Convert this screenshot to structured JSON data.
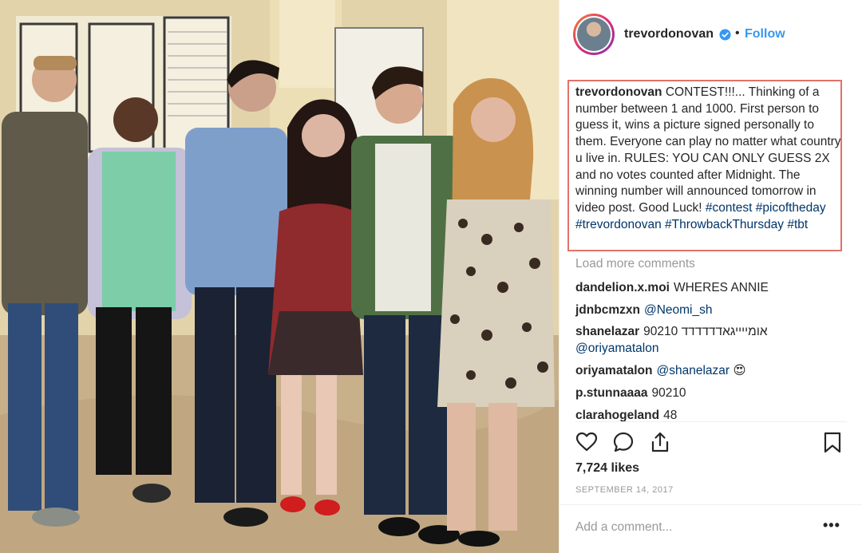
{
  "post": {
    "username": "trevordonovan",
    "follow_label": "Follow",
    "separator": "•",
    "caption_user": "trevordonovan",
    "caption_text": "CONTEST!!!... Thinking of a number between 1 and 1000. First person to guess it, wins a picture signed personally to them. Everyone can play no matter what country u live in. RULES: YOU CAN ONLY GUESS 2X and no votes counted after Midnight. The winning number will announced tomorrow in video post. Good Luck!",
    "hashtags_line1": "#contest #picoftheday",
    "hashtags_line2": "#trevordonovan #ThrowbackThursday #tbt",
    "load_more": "Load more comments",
    "likes": "7,724 likes",
    "date": "SEPTEMBER 14, 2017",
    "add_comment_placeholder": "Add a comment...",
    "more_label": "•••"
  },
  "comments": [
    {
      "user": "dandelion.x.moi",
      "text": "WHERES ANNIE"
    },
    {
      "user": "jdnbcmzxn",
      "text": "@Neomi_sh"
    },
    {
      "user": "shanelazar",
      "text": "90210 אומייייגאדדדדדד",
      "text2": "@oriyamatalon"
    },
    {
      "user": "oriyamatalon",
      "text": "@shanelazar",
      "emoji": "😍"
    },
    {
      "user": "p.stunnaaaa",
      "text": "90210"
    },
    {
      "user": "clarahogeland",
      "text": "48"
    }
  ],
  "icons": {
    "verified": "verified-badge-icon",
    "like": "heart-icon",
    "comment": "comment-bubble-icon",
    "share": "share-icon",
    "save": "bookmark-icon"
  },
  "colors": {
    "accent": "#3897f0",
    "hashtag": "#003569",
    "caption_outline": "#e2726a",
    "muted": "#999999"
  }
}
